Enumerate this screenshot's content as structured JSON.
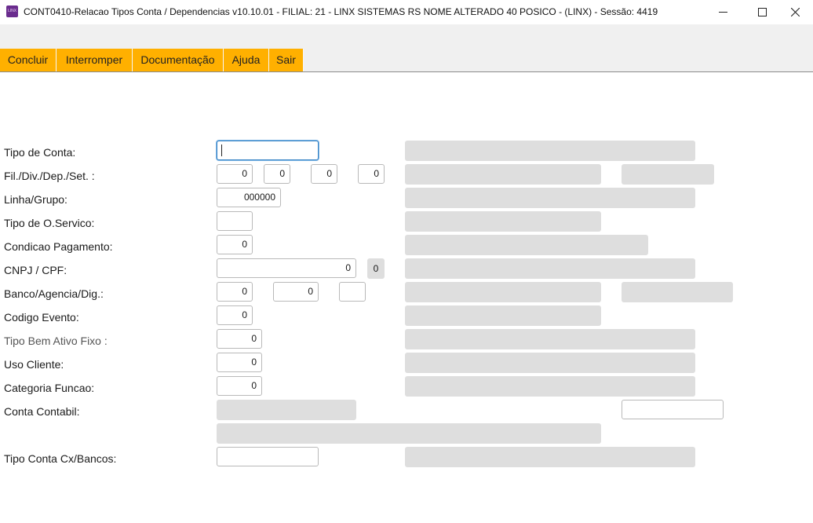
{
  "window": {
    "title": "CONT0410-Relacao Tipos Conta / Dependencias v10.10.01   - FILIAL: 21 - LINX SISTEMAS RS NOME ALTERADO 40 POSICO - (LINX) - Sessão: 4419",
    "icon_text": "LINX"
  },
  "toolbar": {
    "buttons": [
      "Concluir",
      "Interromper",
      "Documentação",
      "Ajuda",
      "Sair"
    ]
  },
  "colors": {
    "accent": "#ffb000",
    "readonly": "#dedede",
    "focus": "#3a85c6"
  },
  "form": {
    "tipo_conta": {
      "label": "Tipo de Conta:",
      "value": ""
    },
    "fil_div": {
      "label": "Fil./Div./Dep./Set. :",
      "values": [
        "0",
        "0",
        "0",
        "0"
      ]
    },
    "linha_grupo": {
      "label": "Linha/Grupo:",
      "value": "000000"
    },
    "tipo_os": {
      "label": "Tipo de O.Servico:",
      "value": ""
    },
    "cond_pagamento": {
      "label": "Condicao Pagamento:",
      "value": "0"
    },
    "cnpj_cpf": {
      "label": "CNPJ / CPF:",
      "value": "0",
      "digit": "0"
    },
    "banco": {
      "label": "Banco/Agencia/Dig.:",
      "values": [
        "0",
        "0",
        ""
      ]
    },
    "codigo_evento": {
      "label": "Codigo Evento:",
      "value": "0"
    },
    "tipo_bem": {
      "label": "Tipo Bem Ativo Fixo :",
      "value": "0"
    },
    "uso_cliente": {
      "label": "Uso Cliente:",
      "value": "0"
    },
    "categoria_funcao": {
      "label": "Categoria Funcao:",
      "value": "0"
    },
    "conta_contabil": {
      "label": "Conta Contabil:",
      "value": ""
    },
    "tipo_conta_cx": {
      "label": "Tipo Conta Cx/Bancos:",
      "value": ""
    }
  }
}
